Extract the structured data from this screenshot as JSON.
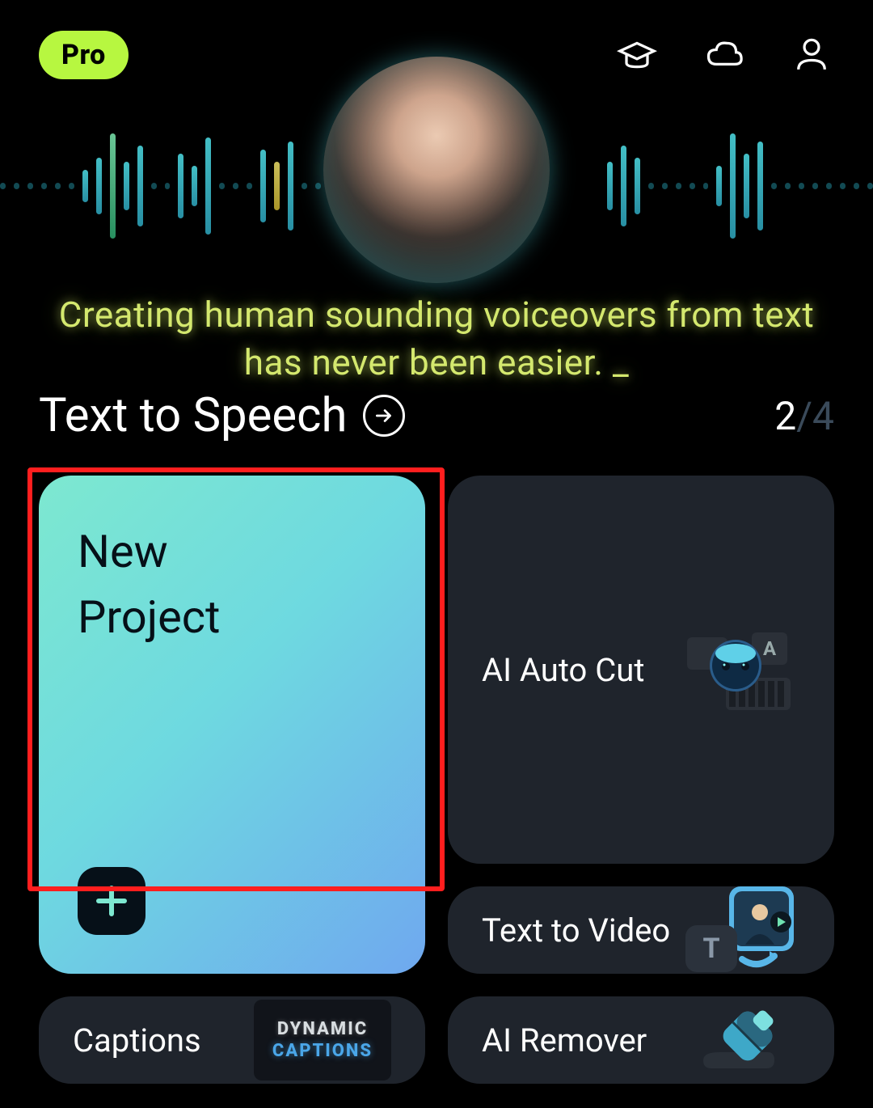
{
  "header": {
    "pro_label": "Pro"
  },
  "hero": {
    "tagline": "Creating human sounding voiceovers from text has never been easier. _"
  },
  "section": {
    "title": "Text to Speech",
    "pager_current": "2",
    "pager_separator": "/",
    "pager_total": "4"
  },
  "cards": {
    "new_project": "New\nProject",
    "ai_auto_cut": "AI Auto Cut",
    "text_to_video": "Text to Video",
    "captions": "Captions",
    "captions_thumb_line1": "DYNAMIC",
    "captions_thumb_line2": "CAPTIONS",
    "ai_remover": "AI Remover"
  }
}
